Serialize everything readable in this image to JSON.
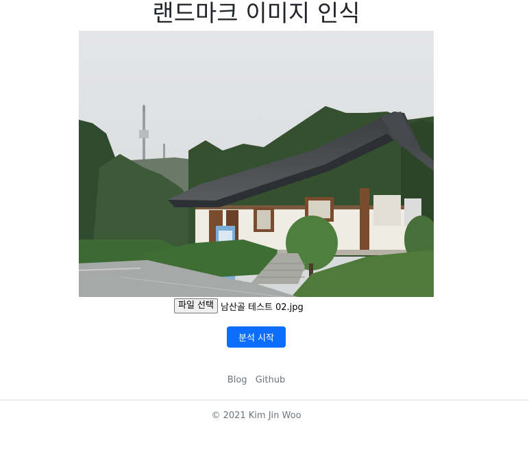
{
  "page": {
    "title": "랜드마크 이미지 인식"
  },
  "upload": {
    "button_label": "파일 선택",
    "file_name": "남산골 테스트 02.jpg"
  },
  "actions": {
    "analyze_label": "분석 시작"
  },
  "footer": {
    "links": [
      {
        "label": "Blog"
      },
      {
        "label": "Github"
      }
    ],
    "copyright": "© 2021 Kim Jin Woo"
  },
  "colors": {
    "primary": "#0d6efd",
    "muted": "#6c757d",
    "divider": "#dee2e6"
  }
}
